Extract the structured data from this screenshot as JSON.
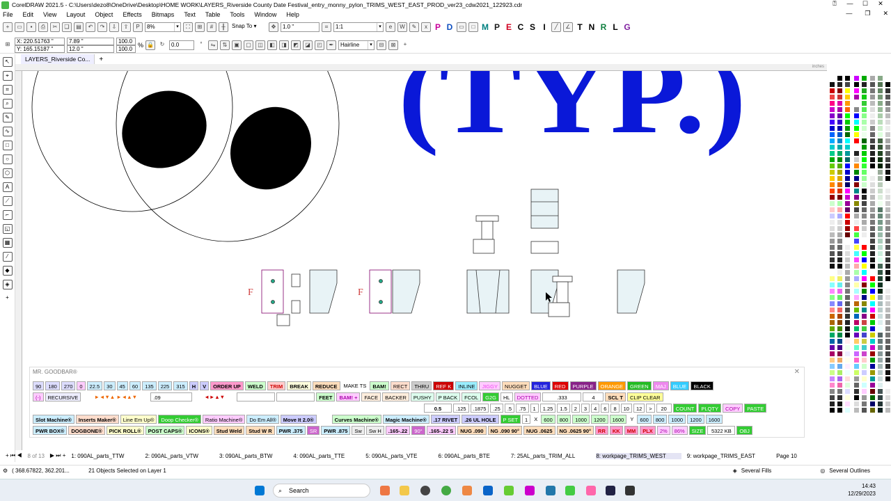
{
  "window": {
    "title": "CorelDRAW 2021.5 - C:\\Users\\dezo8\\OneDrive\\Desktop\\HOME WORK\\LAYERS_Riverside County Date Festival_entry_monny_pylon_TRIMS_WEST_EAST_PROD_ver23_cdw2021_122923.cdr"
  },
  "menu": [
    "File",
    "Edit",
    "View",
    "Layout",
    "Object",
    "Effects",
    "Bitmaps",
    "Text",
    "Table",
    "Tools",
    "Window",
    "Help"
  ],
  "toolbar": {
    "zoom": "8%",
    "snap": "Snap To",
    "nudge": "1.0 \"",
    "scale": "1:1",
    "letters": [
      "P",
      "D",
      "M",
      "P",
      "E",
      "C",
      "S",
      "I",
      "T",
      "N",
      "R",
      "L",
      "G"
    ],
    "letter_colors": [
      "#c8009a",
      "#1050c0",
      "#008080",
      "#1a1a1a",
      "#d00020",
      "#101010",
      "#101010",
      "#101010",
      "#101010",
      "#101010",
      "#108040",
      "#101010",
      "#8020a0"
    ]
  },
  "propbar": {
    "x": "X: 220.51763 \"",
    "y": "Y: 165.15187 \"",
    "w": "7.89 \"",
    "h": "12.0 \"",
    "sx": "100.0",
    "sy": "100.0",
    "pct": "%",
    "rotation": "0.0",
    "outline": "Hairline"
  },
  "doc_tab": "LAYERS_Riverside Co...",
  "ruler_unit": "inches",
  "canvas": {
    "headline": "(TYP.)",
    "headline_color": "#0a18d8"
  },
  "docker": {
    "title": "MR. GOODBAR®",
    "row1": [
      "90",
      "180",
      "270",
      "0",
      "22.5",
      "30",
      "45",
      "60",
      "135",
      "225",
      "315",
      "H",
      "V",
      "ORDER UP",
      "WELD",
      "TRIM",
      "BREAK",
      "REDUCE",
      "MAKE TS",
      "BAM!",
      "RECT",
      "THRU",
      "REF K",
      "INLINE",
      "JIGGY",
      "NUGGET",
      "BLUE",
      "RED",
      "PURPLE",
      "ORANGE",
      "GREEN",
      "MAJ",
      "BLUE",
      "BLACK"
    ],
    "row2": [
      "(-)",
      "RECURSIVE",
      ".09",
      "FEET",
      "BAM! +",
      "FACE",
      "BACKER",
      "PUSHY",
      "P BACK",
      "FCOL",
      "G2G",
      "HL",
      "DOTTED",
      ".333",
      "4",
      "SCL T",
      "CLIP CLEAR"
    ],
    "row3": [
      "0.5",
      ".125",
      ".1875",
      ".25",
      ".5",
      ".75",
      "1",
      "1.25",
      "1.5",
      "2",
      "3",
      "4",
      "6",
      "8",
      "10",
      "12",
      ">",
      "20",
      "COUNT",
      "PLQTY",
      "COPY",
      "PASTE"
    ],
    "row4": [
      "Slot Machine®",
      "Inserts Maker®",
      "Line Em Up®",
      "Doop Checker®",
      "Ratio Machine®",
      "Do Em All®",
      "Move It 2.0®",
      "Curves Machine®",
      "Magic Machine®",
      ".17 RIVET",
      ".26 UL HOLE",
      "P SET",
      "1",
      "X",
      "600",
      "800",
      "1000",
      "1200",
      "1600",
      "Y",
      "600",
      "800",
      "1000",
      "1200",
      "1600"
    ],
    "row5": [
      "PWR BOX®",
      "DOGBONE®",
      "PICK ROLL®",
      "POST CAPS®",
      "ICONS®",
      "Stud Weld",
      "Stud W R",
      "PWR .375",
      "SR",
      "PWR .875",
      "Sw",
      "Sw H",
      ".165-.22",
      "90°",
      ".165-.22 S",
      "NUG .090",
      "NG .090 90°",
      "NUG .0625",
      "NG .0625 90°",
      "RR",
      "KK",
      "MM",
      "PLX",
      "2%",
      "86%",
      "SIZE",
      "5322 KB",
      "OBJ"
    ]
  },
  "pages": {
    "count": "8 of 13",
    "tabs": [
      "1: 090AL_parts_TTW",
      "2: 090AL_parts_VTW",
      "3: 090AL_parts_BTW",
      "4: 090AL_parts_TTE",
      "5: 090AL_parts_VTE",
      "6: 090AL_parts_BTE",
      "7: 25AL_parts_TRIM_ALL",
      "8: workpage_TRIMS_WEST",
      "9: workpage_TRIMS_EAST"
    ],
    "current": "Page 10"
  },
  "status": {
    "coords": "( 368.67822, 362.201... ",
    "selection": "21 Objects Selected on Layer 1",
    "fill": "Several Fills",
    "outline": "Several Outlines"
  },
  "taskbar": {
    "search": "Search",
    "time": "14:43",
    "date": "12/29/2023"
  }
}
